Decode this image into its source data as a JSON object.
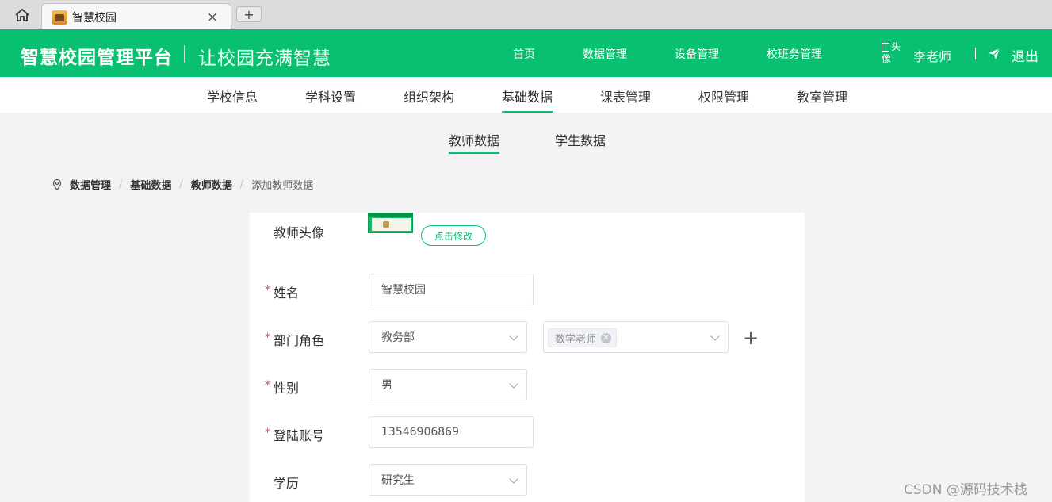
{
  "browser": {
    "tab_title": "智慧校园",
    "close_glyph": "×",
    "newtab_glyph": "+"
  },
  "header": {
    "brand": "智慧校园管理平台",
    "slogan": "让校园充满智慧",
    "nav": [
      "首页",
      "数据管理",
      "设备管理",
      "校班务管理"
    ],
    "avatar_alt": "头像",
    "user_name": "李老师",
    "logout": "退出",
    "color": "#08c070"
  },
  "subnav": {
    "items": [
      "学校信息",
      "学科设置",
      "组织架构",
      "基础数据",
      "课表管理",
      "权限管理",
      "教室管理"
    ],
    "active": "基础数据"
  },
  "data_tabs": {
    "items": [
      "教师数据",
      "学生数据"
    ],
    "active": "教师数据"
  },
  "breadcrumb": {
    "items": [
      "数据管理",
      "基础数据",
      "教师数据"
    ],
    "current": "添加教师数据",
    "separator": "/"
  },
  "form": {
    "avatar_label": "教师头像",
    "modify_button": "点击修改",
    "required_mark": "*",
    "name_label": "姓名",
    "name_value": "智慧校园",
    "dept_role_label": "部门角色",
    "dept_value": "教务部",
    "role_tag": "数学老师",
    "add_glyph": "+",
    "gender_label": "性别",
    "gender_value": "男",
    "account_label": "登陆账号",
    "account_value": "13546906869",
    "education_label": "学历",
    "education_value": "研究生"
  },
  "watermark": "CSDN @源码技术栈"
}
